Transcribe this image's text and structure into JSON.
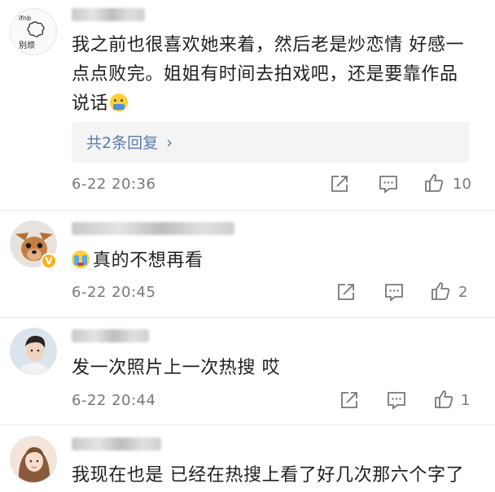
{
  "comments": [
    {
      "avatar": "handwritten-logo-avatar",
      "avatar_text": "ifnb\n别烦我",
      "text_line1": "我之前也很喜欢她来着，然后老是炒恋情 好感一",
      "text_line2": "点点败完。姐姐有时间去拍戏吧，还是要靠作品",
      "text_line3": "说话",
      "emoji": "thinking-face-emoji",
      "replies_label": "共2条回复",
      "time": "6-22 20:36",
      "likes": "10"
    },
    {
      "avatar": "dog-photo-avatar",
      "verified": "V",
      "text": "真的不想再看",
      "emoji": "crying-face-emoji",
      "time": "6-22 20:45",
      "likes": "2"
    },
    {
      "avatar": "man-photo-avatar",
      "text": "发一次照片上一次热搜 哎",
      "time": "6-22 20:44",
      "likes": "1"
    },
    {
      "avatar": "woman-photo-avatar",
      "text": "我现在也是 已经在热搜上看了好几次那六个字了"
    }
  ],
  "icons": {
    "share": "share-icon",
    "comment": "comment-icon",
    "like": "thumbs-up-icon",
    "chevron": "›"
  },
  "colors": {
    "link": "#5b7cab",
    "meta": "#777777",
    "reply_bg": "#f4f4f4"
  }
}
